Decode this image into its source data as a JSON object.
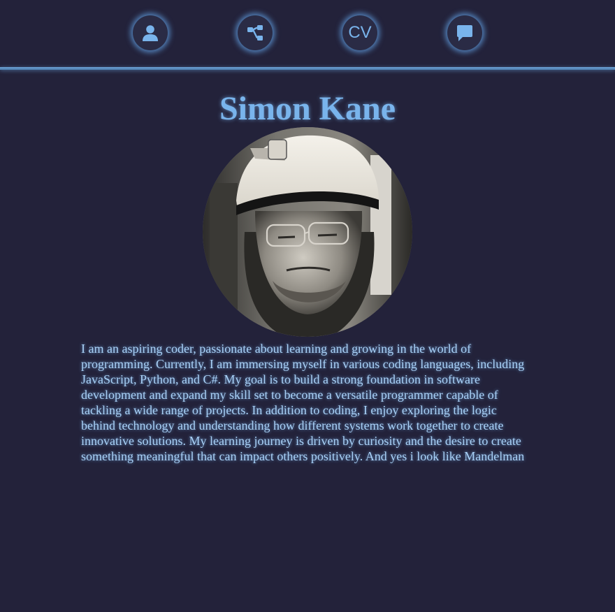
{
  "nav": {
    "items": [
      {
        "icon": "user-icon"
      },
      {
        "icon": "sitemap-icon"
      },
      {
        "icon": "cv-icon",
        "label": "CV"
      },
      {
        "icon": "message-icon"
      }
    ]
  },
  "profile": {
    "name": "Simon Kane",
    "bio": "I am an aspiring coder, passionate about learning and growing in the world of programming. Currently, I am immersing myself in various coding languages, including JavaScript, Python, and C#. My goal is to build a strong foundation in software development and expand my skill set to become a versatile programmer capable of tackling a wide range of projects. In addition to coding, I enjoy exploring the logic behind technology and understanding how different systems work together to create innovative solutions. My learning journey is driven by curiosity and the desire to create something meaningful that can impact others positively. And yes i look like Mandelman"
  },
  "colors": {
    "background": "#23223a",
    "accent": "#79b4ec",
    "text": "#a9d1f7"
  }
}
